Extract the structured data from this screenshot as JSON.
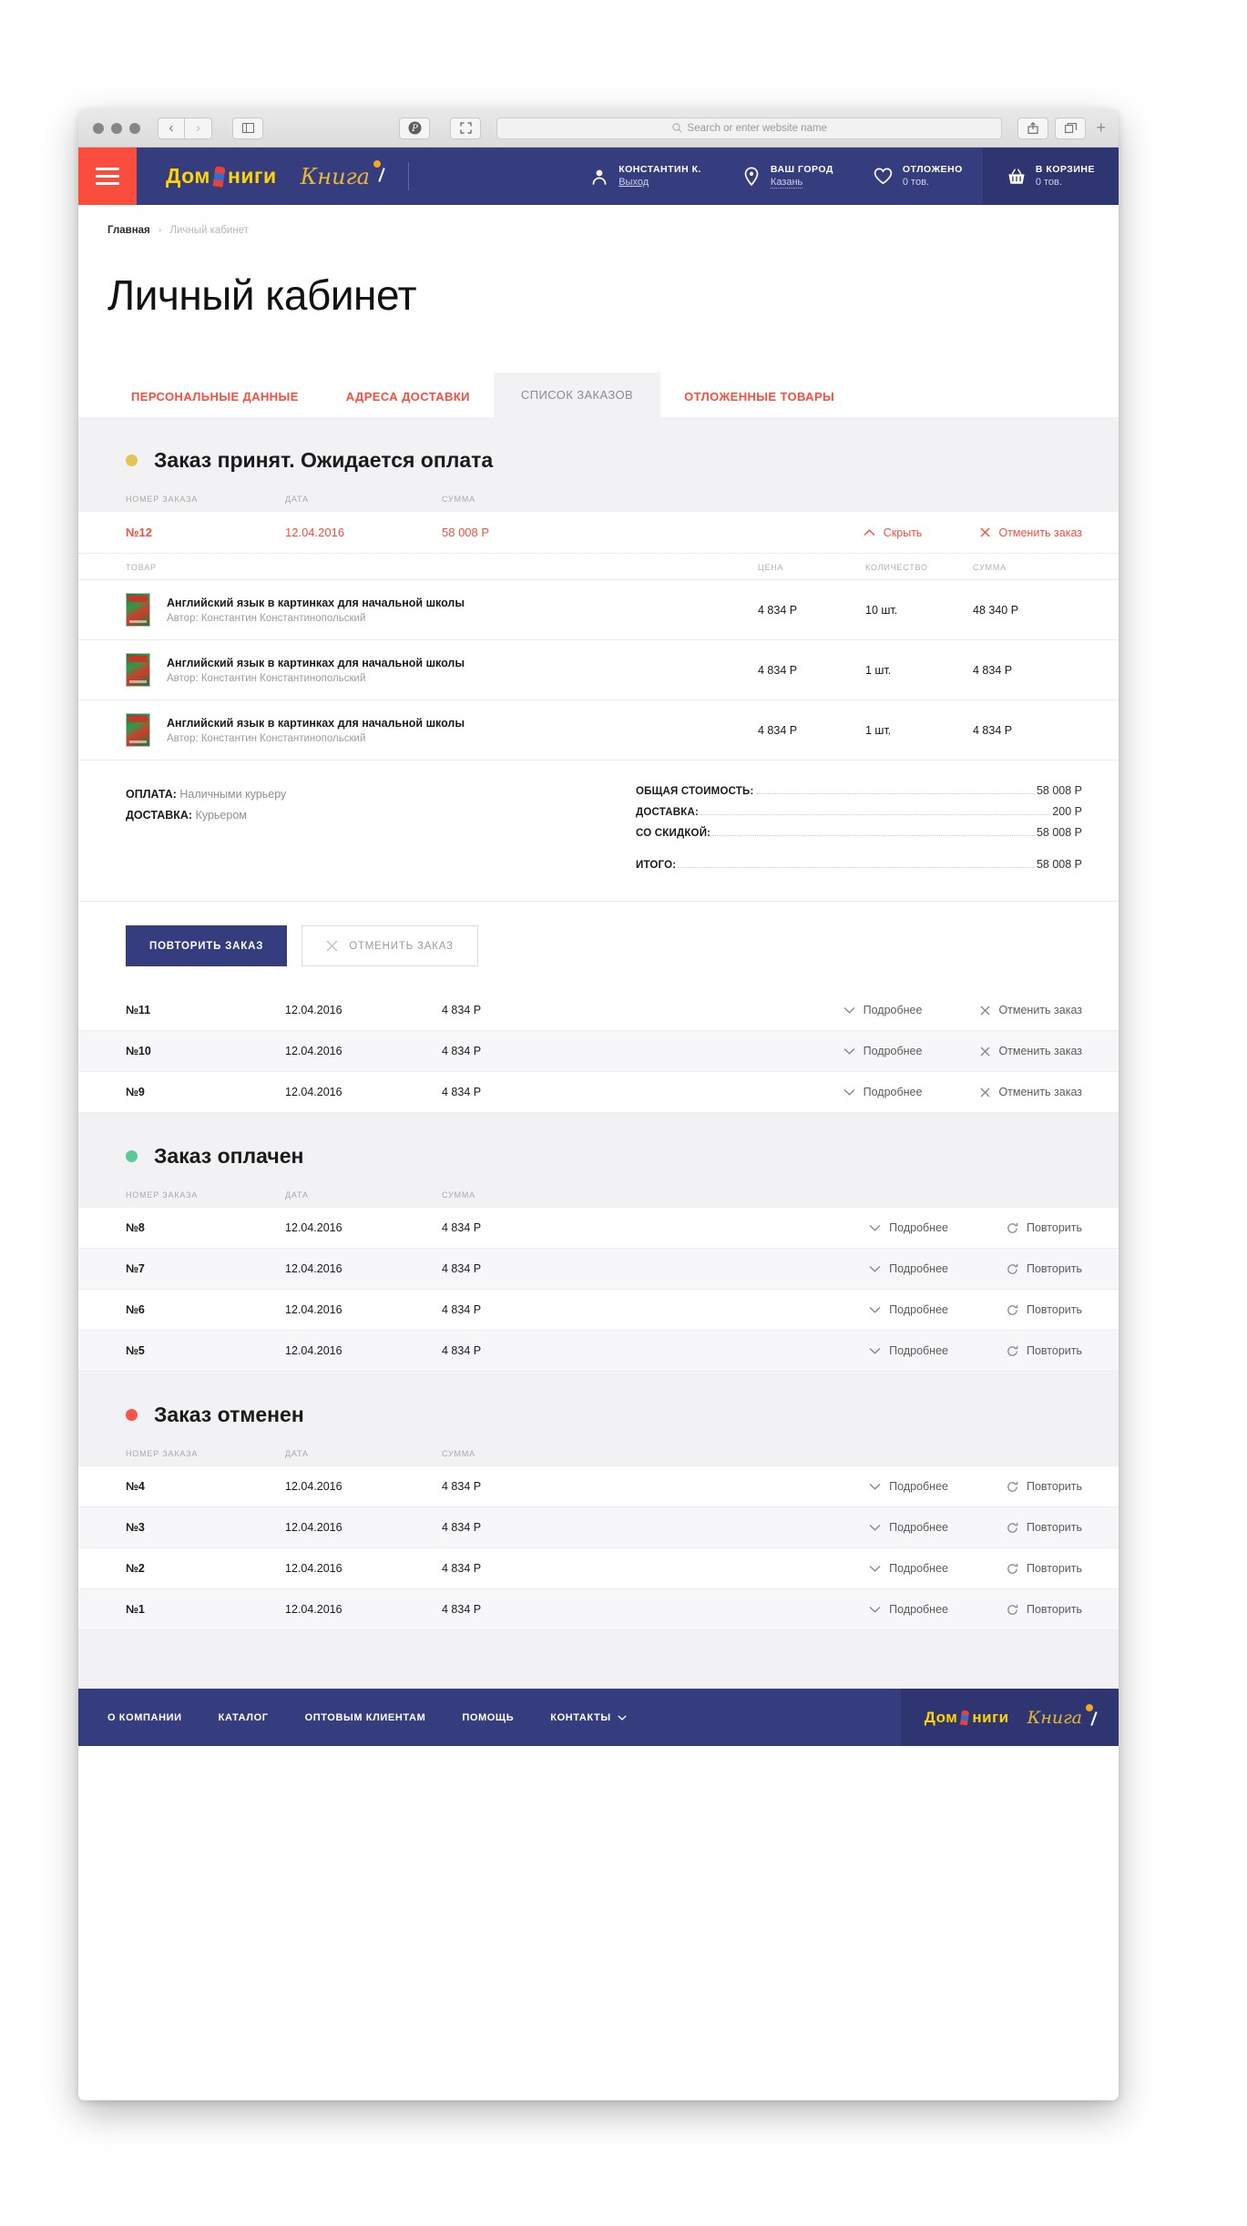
{
  "browser": {
    "search_placeholder": "Search or enter website name",
    "back_icon": "chevron-left-icon",
    "forward_icon": "chevron-right-icon",
    "sidebar_icon": "sidebar-icon",
    "pinterest_icon": "pinterest-icon",
    "expand_icon": "expand-icon",
    "share_icon": "share-icon",
    "tabs_icon": "tabs-icon",
    "newtab_label": "+"
  },
  "header": {
    "menu_icon": "hamburger-menu-icon",
    "logo_primary": "Дом Книги",
    "logo_secondary": "Книга",
    "account": {
      "title": "КОНСТАНТИН К.",
      "sub": "Выход",
      "icon": "user-icon"
    },
    "city": {
      "title": "ВАШ ГОРОД",
      "sub": "Казань",
      "icon": "location-pin-icon"
    },
    "wishlist": {
      "title": "ОТЛОЖЕНО",
      "sub": "0 тов.",
      "icon": "heart-icon"
    },
    "cart": {
      "title": "В КОРЗИНЕ",
      "sub": "0 тов.",
      "icon": "basket-icon"
    }
  },
  "breadcrumb": {
    "home": "Главная",
    "separator": "›",
    "current": "Личный кабинет"
  },
  "page": {
    "title": "Личный кабинет"
  },
  "tabs": [
    {
      "label": "ПЕРСОНАЛЬНЫЕ ДАННЫЕ",
      "active": false
    },
    {
      "label": "АДРЕСА ДОСТАВКИ",
      "active": false
    },
    {
      "label": "СПИСОК ЗАКАЗОВ",
      "active": true
    },
    {
      "label": "ОТЛОЖЕННЫЕ ТОВАРЫ",
      "active": false
    }
  ],
  "columns": {
    "number": "НОМЕР ЗАКАЗА",
    "date": "ДАТА",
    "sum": "СУММА"
  },
  "product_columns": {
    "product": "ТОВАР",
    "price": "ЦЕНА",
    "qty": "КОЛИЧЕСТВО",
    "sum": "СУММА"
  },
  "actions": {
    "hide": "Скрыть",
    "details": "Подробнее",
    "cancel_order": "Отменить заказ",
    "repeat": "Повторить",
    "repeat_order_button": "ПОВТОРИТЬ ЗАКАЗ",
    "cancel_order_button": "ОТМЕНИТЬ ЗАКАЗ"
  },
  "colors": {
    "accent_red": "#fb4d3d",
    "navy": "#363d7e",
    "status_pending": "#e2c552",
    "status_paid": "#5fc89a",
    "status_cancelled": "#fb5348"
  },
  "groups": [
    {
      "status_label": "Заказ принят. Ожидается оплата",
      "status_color": "#e2c552",
      "expanded_order": {
        "number": "№12",
        "date": "12.04.2016",
        "sum": "58 008 Р",
        "items": [
          {
            "name": "Английский язык в картинках для начальной школы",
            "author": "Автор: Константин Константинопольский",
            "price": "4 834 Р",
            "qty": "10 шт.",
            "sum": "48 340 Р"
          },
          {
            "name": "Английский язык в картинках для начальной школы",
            "author": "Автор: Константин Константинопольский",
            "price": "4 834 Р",
            "qty": "1 шт.",
            "sum": "4 834 Р"
          },
          {
            "name": "Английский язык в картинках для начальной школы",
            "author": "Автор: Константин Константинопольский",
            "price": "4 834 Р",
            "qty": "1 шт.",
            "sum": "4 834 Р"
          }
        ],
        "payment_label": "ОПЛАТА:",
        "payment_value": "Наличными курьеру",
        "delivery_label": "ДОСТАВКА:",
        "delivery_value": "Курьером",
        "totals": [
          {
            "label": "ОБЩАЯ СТОИМОСТЬ:",
            "value": "58 008 Р"
          },
          {
            "label": "ДОСТАВКА:",
            "value": "200 Р"
          },
          {
            "label": "СО СКИДКОЙ:",
            "value": "58 008 Р"
          }
        ],
        "grand_total": {
          "label": "ИТОГО:",
          "value": "58 008 Р"
        }
      },
      "orders": [
        {
          "number": "№11",
          "date": "12.04.2016",
          "sum": "4 834 Р",
          "action": "Подробнее",
          "action2": "Отменить заказ"
        },
        {
          "number": "№10",
          "date": "12.04.2016",
          "sum": "4 834 Р",
          "action": "Подробнее",
          "action2": "Отменить заказ"
        },
        {
          "number": "№9",
          "date": "12.04.2016",
          "sum": "4 834 Р",
          "action": "Подробнее",
          "action2": "Отменить заказ"
        }
      ]
    },
    {
      "status_label": "Заказ оплачен",
      "status_color": "#5fc89a",
      "orders": [
        {
          "number": "№8",
          "date": "12.04.2016",
          "sum": "4 834 Р",
          "action": "Подробнее",
          "action2": "Повторить"
        },
        {
          "number": "№7",
          "date": "12.04.2016",
          "sum": "4 834 Р",
          "action": "Подробнее",
          "action2": "Повторить"
        },
        {
          "number": "№6",
          "date": "12.04.2016",
          "sum": "4 834 Р",
          "action": "Подробнее",
          "action2": "Повторить"
        },
        {
          "number": "№5",
          "date": "12.04.2016",
          "sum": "4 834 Р",
          "action": "Подробнее",
          "action2": "Повторить"
        }
      ]
    },
    {
      "status_label": "Заказ отменен",
      "status_color": "#fb5348",
      "orders": [
        {
          "number": "№4",
          "date": "12.04.2016",
          "sum": "4 834 Р",
          "action": "Подробнее",
          "action2": "Повторить"
        },
        {
          "number": "№3",
          "date": "12.04.2016",
          "sum": "4 834 Р",
          "action": "Подробнее",
          "action2": "Повторить"
        },
        {
          "number": "№2",
          "date": "12.04.2016",
          "sum": "4 834 Р",
          "action": "Подробнее",
          "action2": "Повторить"
        },
        {
          "number": "№1",
          "date": "12.04.2016",
          "sum": "4 834 Р",
          "action": "Подробнее",
          "action2": "Повторить"
        }
      ]
    }
  ],
  "footer": {
    "links": [
      {
        "label": "О КОМПАНИИ",
        "caret": false
      },
      {
        "label": "КАТАЛОГ",
        "caret": false
      },
      {
        "label": "ОПТОВЫМ КЛИЕНТАМ",
        "caret": false
      },
      {
        "label": "ПОМОЩЬ",
        "caret": false
      },
      {
        "label": "КОНТАКТЫ",
        "caret": true
      }
    ],
    "logo_primary": "Дом Книги",
    "logo_secondary": "Книга"
  }
}
